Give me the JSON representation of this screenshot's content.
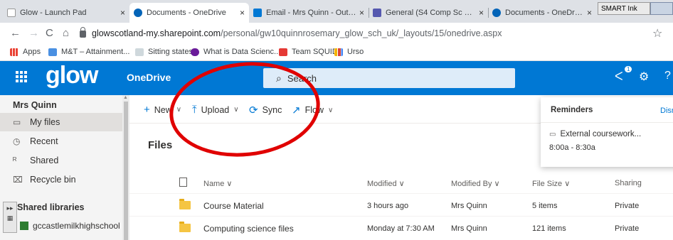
{
  "browser": {
    "tabs": [
      {
        "title": "Glow - Launch Pad",
        "icon": "glow-favicon",
        "color": "#ffffff"
      },
      {
        "title": "Documents - OneDrive",
        "icon": "onedrive-favicon",
        "color": "#0364b8"
      },
      {
        "title": "Email - Mrs Quinn - Outlook",
        "icon": "outlook-favicon",
        "color": "#0078d4"
      },
      {
        "title": "General (S4 Comp Sc 2020) |",
        "icon": "teams-favicon",
        "color": "#5558af"
      },
      {
        "title": "Documents - OneDrive",
        "icon": "onedrive-favicon",
        "color": "#0364b8"
      }
    ],
    "tab_close": "×",
    "smart_ink_label": "SMART Ink",
    "url_host": "glowscotland-my.sharepoint.com",
    "url_path": "/personal/gw10quinnrosemary_glow_sch_uk/_layouts/15/onedrive.aspx",
    "bookmarks": [
      {
        "label": "Apps",
        "icon": "apps-grid-icon",
        "color": "#4285f4"
      },
      {
        "label": "M&T – Attainment...",
        "icon": "page-icon",
        "color": "#4a90e2"
      },
      {
        "label": "Sitting states",
        "icon": "page-icon",
        "color": "#9e9e9e"
      },
      {
        "label": "What is Data Scienc...",
        "icon": "brand-icon",
        "color": "#6a1b9a"
      },
      {
        "label": "Team SQUID",
        "icon": "youtube-icon",
        "color": "#e53935"
      },
      {
        "label": "Urso",
        "icon": "bars-icon",
        "color": "#f4b400"
      }
    ]
  },
  "suitebar": {
    "brand": "glow",
    "app": "OneDrive",
    "search_placeholder": "Search",
    "notification_count": "1",
    "accent": "#0078d4"
  },
  "nav": {
    "user": "Mrs Quinn",
    "items": [
      {
        "label": "My files",
        "icon": "folder-outline-icon",
        "selected": true
      },
      {
        "label": "Recent",
        "icon": "clock-icon",
        "selected": false
      },
      {
        "label": "Shared",
        "icon": "people-icon",
        "selected": false
      },
      {
        "label": "Recycle bin",
        "icon": "trash-icon",
        "selected": false
      }
    ],
    "section_title": "Shared libraries",
    "site": "gccastlemilkhighschool"
  },
  "commands": {
    "new": "New",
    "upload": "Upload",
    "sync": "Sync",
    "flow": "Flow"
  },
  "files": {
    "title": "Files",
    "columns": {
      "name": "Name",
      "modified": "Modified",
      "modified_by": "Modified By",
      "file_size": "File Size",
      "sharing": "Sharing"
    },
    "rows": [
      {
        "name": "Course Material",
        "modified": "3 hours ago",
        "modified_by": "Mrs Quinn",
        "size": "5 items",
        "sharing": "Private"
      },
      {
        "name": "Computing science files",
        "modified": "Monday at 7:30 AM",
        "modified_by": "Mrs Quinn",
        "size": "121 items",
        "sharing": "Private"
      }
    ]
  },
  "reminders": {
    "title": "Reminders",
    "dismiss": "Dism",
    "event": "External coursework...",
    "time": "8:00a - 8:30a"
  },
  "annotation_color": "#e00000"
}
